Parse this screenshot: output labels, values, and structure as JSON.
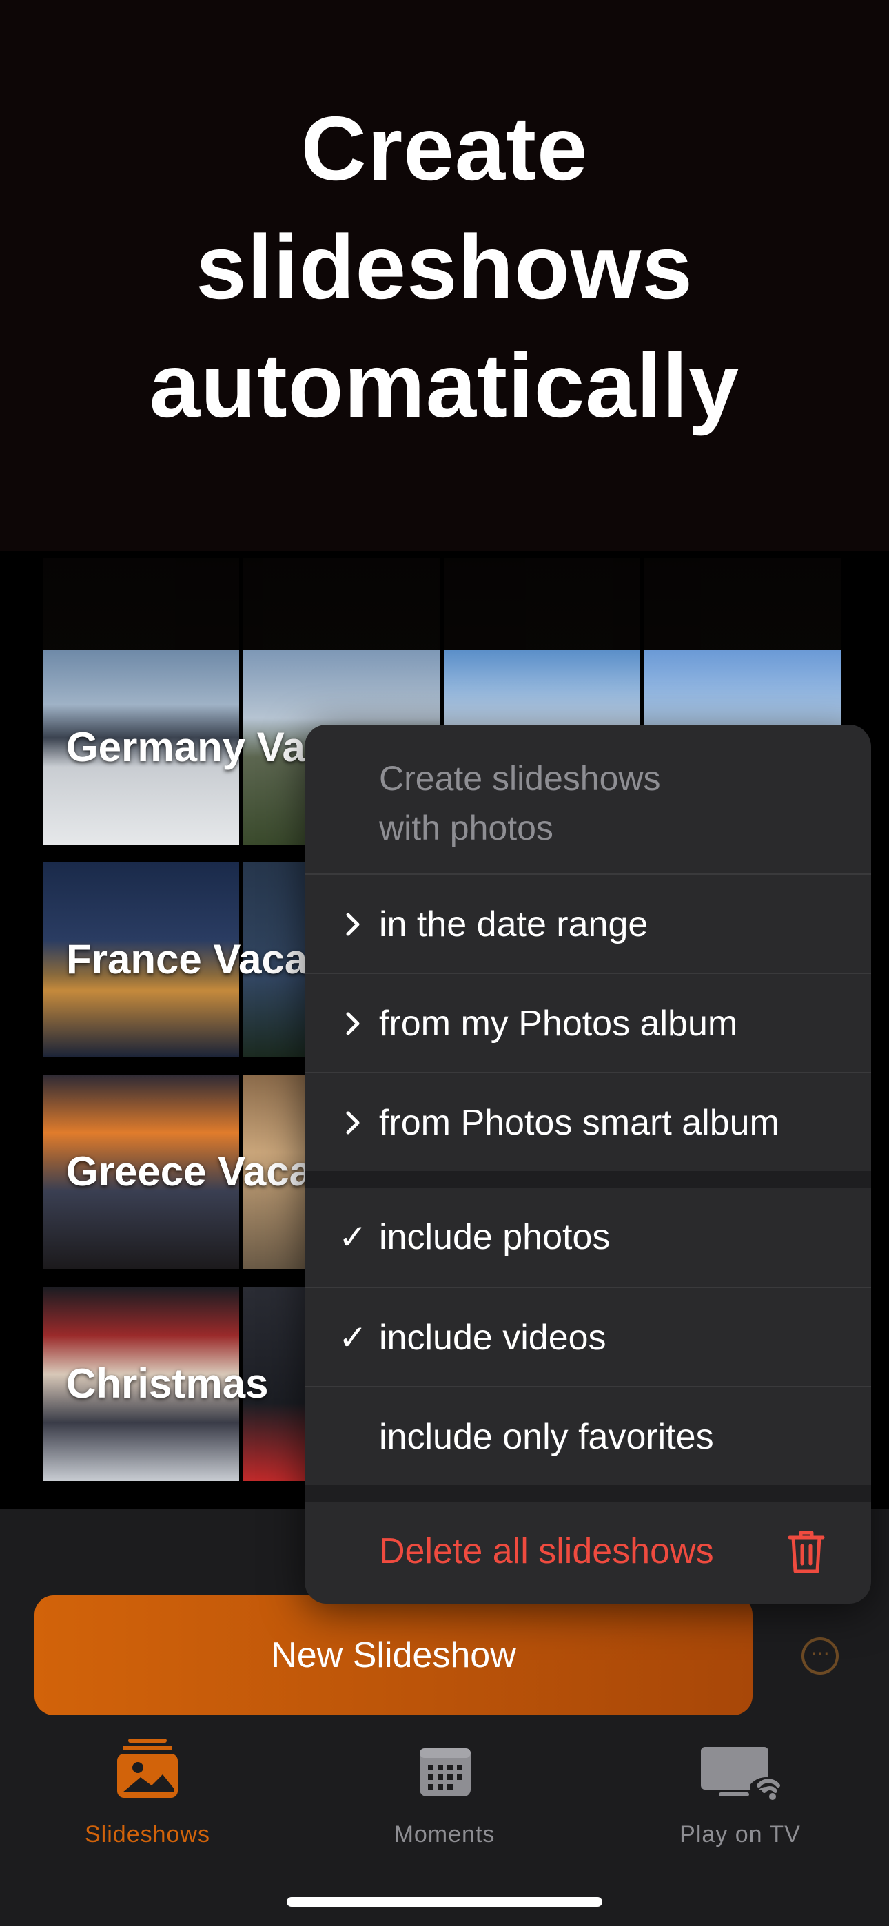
{
  "hero": {
    "title_lines": [
      "Create",
      "slideshows",
      "automatically"
    ]
  },
  "slideshows": [
    {
      "label": "Germany Va"
    },
    {
      "label": "France Vaca"
    },
    {
      "label": "Greece Vaca"
    },
    {
      "label": "Christmas"
    }
  ],
  "menu": {
    "header": "Create slideshows\nwith photos",
    "submenus": [
      {
        "label": "in the date range",
        "icon": "chevron-right"
      },
      {
        "label": "from my Photos album",
        "icon": "chevron-right"
      },
      {
        "label": "from Photos smart album",
        "icon": "chevron-right"
      }
    ],
    "toggles": [
      {
        "label": "include photos",
        "checked": true
      },
      {
        "label": "include videos",
        "checked": true
      },
      {
        "label": "include only favorites",
        "checked": false
      }
    ],
    "delete_label": "Delete all slideshows"
  },
  "actions": {
    "new_slideshow": "New Slideshow",
    "more_icon": "ellipsis-circle-icon"
  },
  "tabs": [
    {
      "label": "Slideshows",
      "icon": "slideshows-icon",
      "active": true
    },
    {
      "label": "Moments",
      "icon": "calendar-icon",
      "active": false
    },
    {
      "label": "Play on TV",
      "icon": "tv-icon",
      "active": false
    }
  ],
  "colors": {
    "accent": "#d2630a",
    "destructive": "#ef4b3f",
    "hero_bg": "#0d0606",
    "menu_bg": "#2a2a2c"
  }
}
